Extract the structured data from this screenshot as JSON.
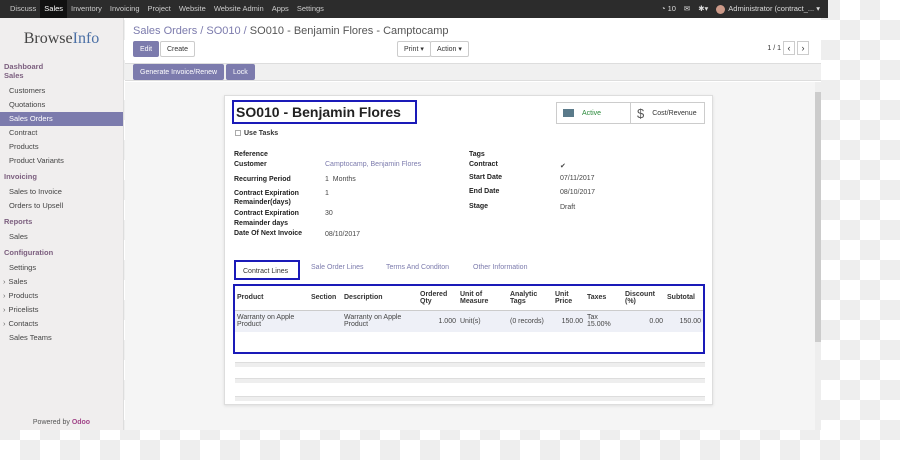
{
  "topbar": {
    "apps": [
      "Discuss",
      "Sales",
      "Inventory",
      "Invoicing",
      "Project",
      "Website",
      "Website Admin",
      "Apps",
      "Settings"
    ],
    "active_app": "Sales",
    "chat_count": "10",
    "user": "Administrator (contract_..."
  },
  "sidebar": {
    "logo_part1": "Browse",
    "logo_part2": "Info",
    "sections": [
      {
        "head": "Dashboard",
        "items": []
      },
      {
        "head": "Sales",
        "items": [
          "Customers",
          "Quotations",
          "Sales Orders",
          "Contract",
          "Products",
          "Product Variants"
        ]
      },
      {
        "head": "Invoicing",
        "items": [
          "Sales to Invoice",
          "Orders to Upsell"
        ]
      },
      {
        "head": "Reports",
        "items": [
          "Sales"
        ]
      },
      {
        "head": "Configuration",
        "items": [
          "Settings",
          "Sales",
          "Products",
          "Pricelists",
          "Contacts",
          "Sales Teams"
        ]
      }
    ],
    "powered_prefix": "Powered by",
    "powered_brand": "Odoo"
  },
  "breadcrumb": {
    "root": "Sales Orders",
    "mid": "SO010",
    "current": "SO010 - Benjamin Flores - Camptocamp"
  },
  "toolbar": {
    "edit": "Edit",
    "create": "Create",
    "print": "Print ▾",
    "action": "Action ▾",
    "pager": "1 / 1"
  },
  "statusbar": {
    "generate": "Generate Invoice/Renew",
    "lock": "Lock"
  },
  "form": {
    "title": "SO010 - Benjamin Flores",
    "active_label": "Active",
    "cost_label": "Cost/Revenue",
    "use_tasks": "Use Tasks",
    "left_labels": [
      "Reference",
      "Customer",
      "Recurring Period",
      "Contract Expiration",
      "Remainder(days)",
      "Contract Expiration",
      "Remainder days",
      "Date Of Next Invoice"
    ],
    "customer": "Camptocamp, Benjamin Flores",
    "recurring_num": "1",
    "recurring_unit": "Months",
    "exp_remainder": "1",
    "exp_remainder2": "30",
    "next_invoice": "08/10/2017",
    "right_labels": [
      "Tags",
      "Contract",
      "Start Date",
      "End Date",
      "Stage"
    ],
    "contract_check": "✔",
    "start_date": "07/11/2017",
    "end_date": "08/10/2017",
    "stage": "Draft"
  },
  "tabs": [
    "Contract Lines",
    "Sale Order Lines",
    "Terms And Conditon",
    "Other Information"
  ],
  "table": {
    "headers": [
      "Product",
      "Section",
      "Description",
      "Ordered Qty",
      "Unit of Measure",
      "Analytic Tags",
      "Unit Price",
      "Taxes",
      "Discount (%)",
      "Subtotal"
    ],
    "row": [
      "Warranty on Apple Product",
      "",
      "Warranty on Apple Product",
      "1.000",
      "Unit(s)",
      "(0 records)",
      "150.00",
      "Tax 15.00%",
      "0.00",
      "150.00"
    ]
  }
}
